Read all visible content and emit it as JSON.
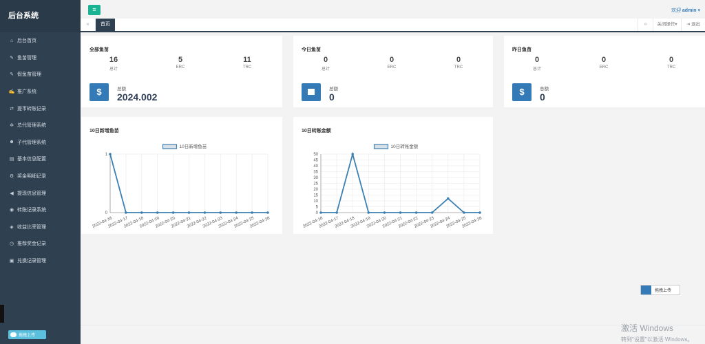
{
  "app": {
    "title": "后台系统"
  },
  "sidebar": {
    "items": [
      {
        "icon": "home-icon",
        "glyph": "⌂",
        "label": "后台首页"
      },
      {
        "icon": "wrench-icon",
        "glyph": "✎",
        "label": "鱼苗管理"
      },
      {
        "icon": "wrench-icon",
        "glyph": "✎",
        "label": "假鱼苗管理"
      },
      {
        "icon": "edit-icon",
        "glyph": "✍",
        "label": "推广系统"
      },
      {
        "icon": "shuffle-icon",
        "glyph": "⇄",
        "label": "提币转账记录"
      },
      {
        "icon": "gear-icon",
        "glyph": "✲",
        "label": "总代管理系统"
      },
      {
        "icon": "users-icon",
        "glyph": "☻",
        "label": "子代管理系统"
      },
      {
        "icon": "file-icon",
        "glyph": "▤",
        "label": "基本信息配置"
      },
      {
        "icon": "cogs-icon",
        "glyph": "⚙",
        "label": "奖金明细记录"
      },
      {
        "icon": "bullhorn-icon",
        "glyph": "◀",
        "label": "提现信息管理"
      },
      {
        "icon": "car-icon",
        "glyph": "◉",
        "label": "转账记录系统"
      },
      {
        "icon": "shield-icon",
        "glyph": "◈",
        "label": "收益比率管理"
      },
      {
        "icon": "clock-icon",
        "glyph": "◷",
        "label": "推荐奖金记录"
      },
      {
        "icon": "list-icon",
        "glyph": "▣",
        "label": "兑换记录管理"
      }
    ],
    "upload_label": "拖拽上传"
  },
  "topbar": {
    "welcome_prefix": "欢迎",
    "user": "admin"
  },
  "tabs": {
    "active": "首页",
    "close_ops": "关闭操作",
    "logout": "退出"
  },
  "stats_cards": [
    {
      "title": "全部鱼苗",
      "stats": [
        {
          "value": "16",
          "label": "总计"
        },
        {
          "value": "5",
          "label": "ERC"
        },
        {
          "value": "11",
          "label": "TRC"
        }
      ],
      "icon": "dollar-icon",
      "icon_glyph": "$",
      "total_label": "总额",
      "total_value": "2024.002"
    },
    {
      "title": "今日鱼苗",
      "stats": [
        {
          "value": "0",
          "label": "总计"
        },
        {
          "value": "0",
          "label": "ERC"
        },
        {
          "value": "0",
          "label": "TRC"
        }
      ],
      "icon": "archive-icon",
      "icon_glyph": "",
      "total_label": "总额",
      "total_value": "0"
    },
    {
      "title": "昨日鱼苗",
      "stats": [
        {
          "value": "0",
          "label": "总计"
        },
        {
          "value": "0",
          "label": "ERC"
        },
        {
          "value": "0",
          "label": "TRC"
        }
      ],
      "icon": "dollar-icon",
      "icon_glyph": "$",
      "total_label": "总额",
      "total_value": "0"
    }
  ],
  "chart_cards": [
    {
      "title": "10日新增鱼苗"
    },
    {
      "title": "10日转账金额"
    }
  ],
  "chart_data": [
    {
      "type": "line",
      "title": "",
      "legend": "top-center",
      "categories": [
        "2022-04-16",
        "2022-04-17",
        "2022-04-18",
        "2022-04-19",
        "2022-04-20",
        "2022-04-21",
        "2022-04-22",
        "2022-04-23",
        "2022-04-24",
        "2022-04-25",
        "2022-04-26"
      ],
      "series": [
        {
          "name": "10日新增鱼苗",
          "values": [
            1,
            0,
            0,
            0,
            0,
            0,
            0,
            0,
            0,
            0,
            0
          ]
        }
      ],
      "ylim": [
        0,
        1
      ],
      "yticks": [
        0,
        1
      ],
      "grid": true,
      "color": "#3c7fb1"
    },
    {
      "type": "line",
      "title": "",
      "legend": "top-center",
      "categories": [
        "2022-04-16",
        "2022-04-17",
        "2022-04-18",
        "2022-04-19",
        "2022-04-20",
        "2022-04-21",
        "2022-04-22",
        "2022-04-23",
        "2022-04-24",
        "2022-04-25",
        "2022-04-26"
      ],
      "series": [
        {
          "name": "10日转账金额",
          "values": [
            0,
            0,
            50,
            0,
            0,
            0,
            0,
            0,
            12,
            0,
            0
          ]
        }
      ],
      "ylim": [
        0,
        50
      ],
      "yticks": [
        0,
        5,
        10,
        15,
        20,
        25,
        30,
        35,
        40,
        45,
        50
      ],
      "grid": true,
      "color": "#3c7fb1"
    }
  ],
  "drag_upload_label": "拖拽上传",
  "watermark": {
    "line1": "激活 Windows",
    "line2": "转到\"设置\"以激活 Windows。"
  }
}
